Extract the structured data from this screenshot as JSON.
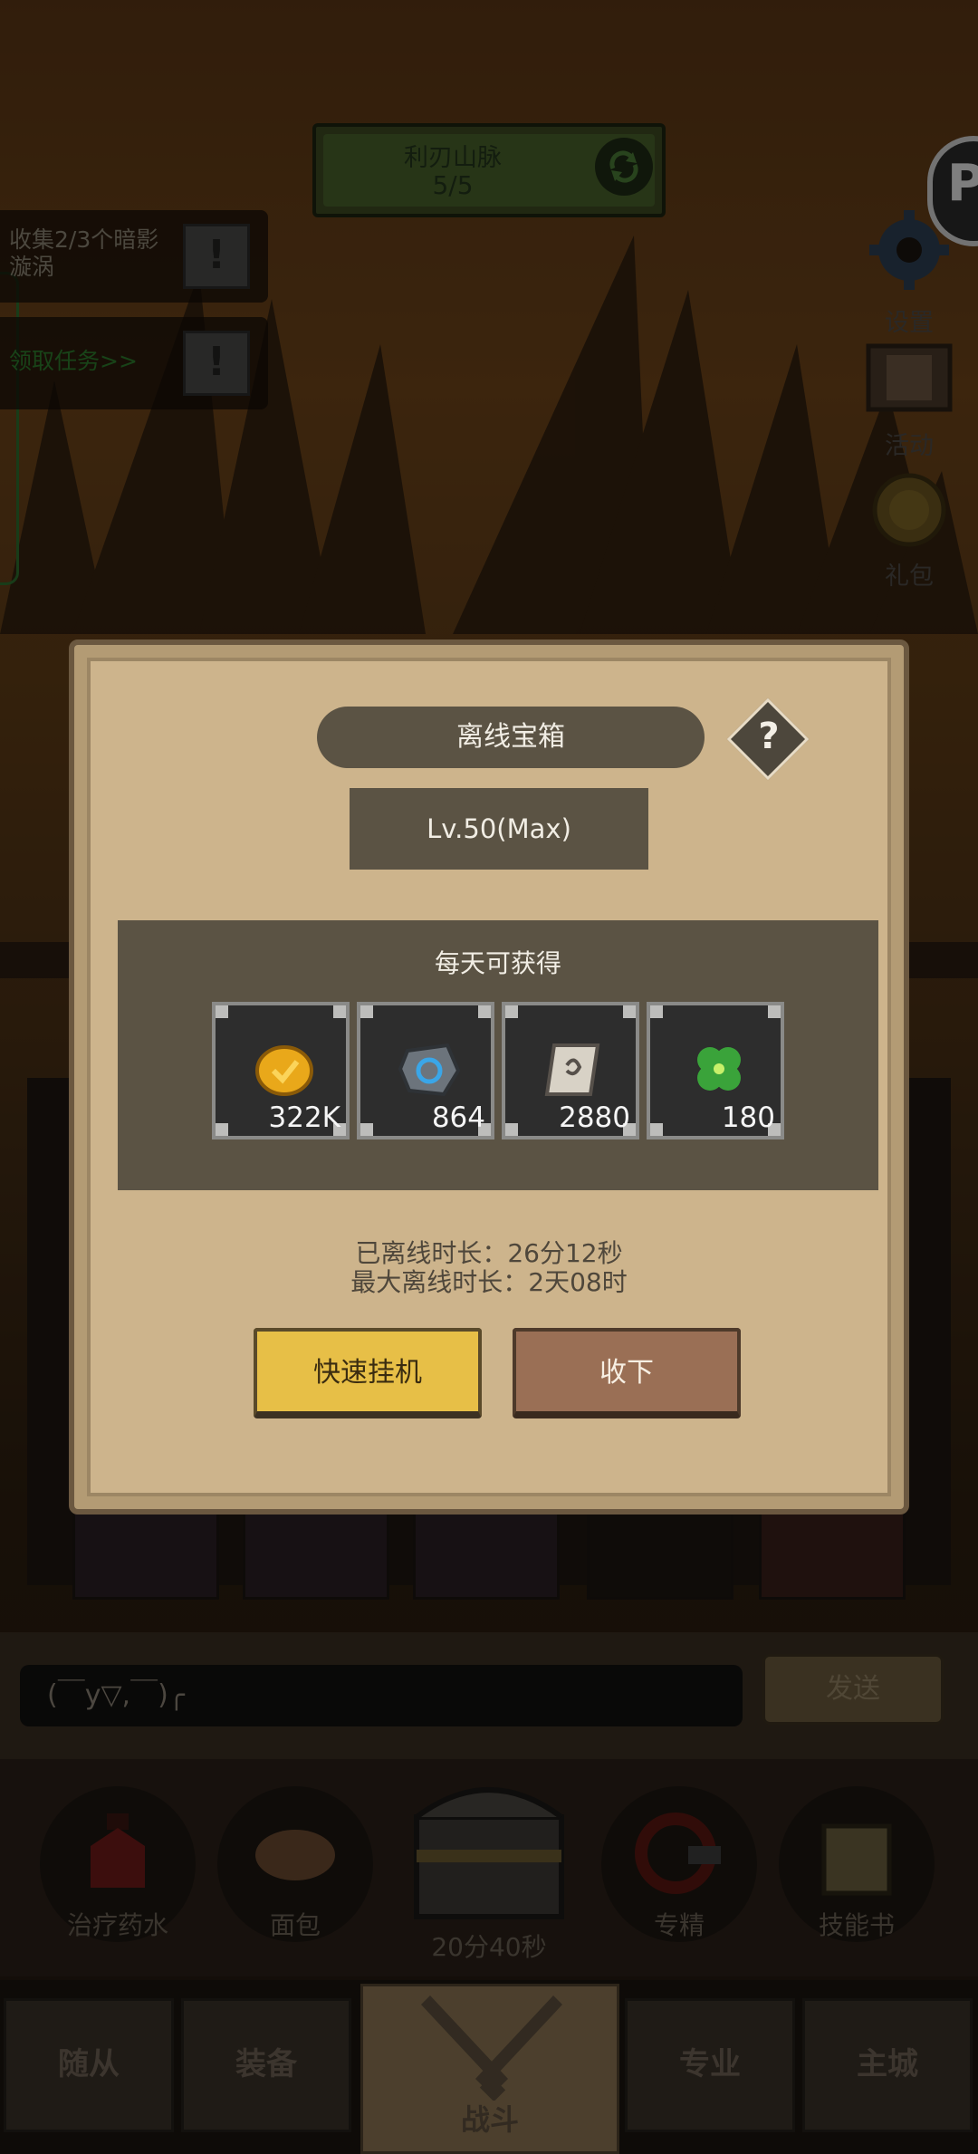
{
  "stage": {
    "name": "利刃山脉",
    "progress": "5/5"
  },
  "quests": [
    {
      "text": "收集2/3个暗影漩涡",
      "state": "active"
    },
    {
      "text": "领取任务>>",
      "state": "available"
    }
  ],
  "side_menu": {
    "settings": "设置",
    "events": "活动",
    "gift": "礼包"
  },
  "dialog": {
    "title": "离线宝箱",
    "help": "?",
    "level": "Lv.50(Max)",
    "rewards_title": "每天可获得",
    "rewards": [
      {
        "icon": "gold-coin-icon",
        "qty": "322K"
      },
      {
        "icon": "rune-stone-icon",
        "qty": "864"
      },
      {
        "icon": "scroll-icon",
        "qty": "2880"
      },
      {
        "icon": "clover-icon",
        "qty": "180"
      }
    ],
    "offline_time": "已离线时长：26分12秒",
    "max_offline_time": "最大离线时长：2天08时",
    "quick_idle_label": "快速挂机",
    "collect_label": "收下"
  },
  "chat": {
    "input_value": "(￣y▽,￣)╭",
    "send_label": "发送"
  },
  "actions": {
    "potion": "治疗药水",
    "bread": "面包",
    "chest_timer": "20分40秒",
    "specialty": "专精",
    "skill_book": "技能书"
  },
  "nav": {
    "followers": "随从",
    "equipment": "装备",
    "battle": "战斗",
    "profession": "专业",
    "main_city": "主城"
  },
  "colors": {
    "accent_yellow": "#e7bf47",
    "dialog_bg": "#cdb48c",
    "panel_dark": "#5b5344",
    "quest_green": "#2c7a2c"
  }
}
